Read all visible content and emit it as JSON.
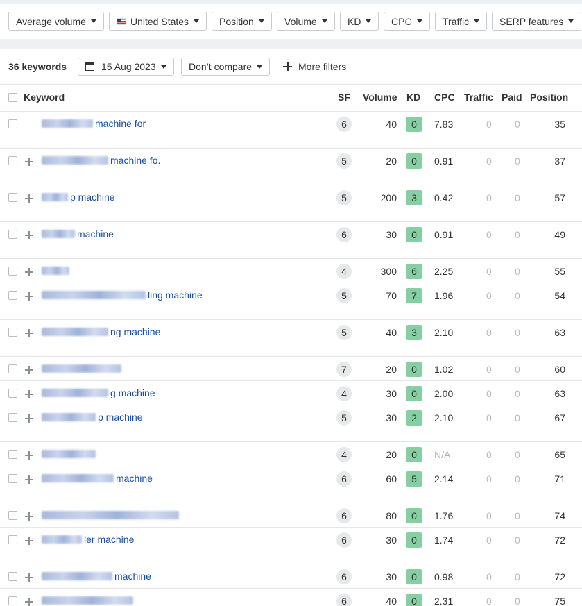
{
  "filters": [
    {
      "label": "Average volume"
    },
    {
      "label": "United States",
      "flag": true
    },
    {
      "label": "Position"
    },
    {
      "label": "Volume"
    },
    {
      "label": "KD"
    },
    {
      "label": "CPC"
    },
    {
      "label": "Traffic"
    },
    {
      "label": "SERP features"
    }
  ],
  "subbar": {
    "keyword_count": "36 keywords",
    "date": "15 Aug 2023",
    "compare": "Don’t compare",
    "more_filters": "More filters"
  },
  "table": {
    "headers": {
      "keyword": "Keyword",
      "sf": "SF",
      "volume": "Volume",
      "kd": "KD",
      "cpc": "CPC",
      "traffic": "Traffic",
      "paid": "Paid",
      "position": "Position"
    },
    "rows": [
      {
        "kw": "machine for",
        "sf": "6",
        "volume": "40",
        "kd": "0",
        "cpc": "7.83",
        "traffic": "0",
        "paid": "0",
        "position": "35"
      },
      {
        "kw": "machine fo.",
        "sf": "5",
        "volume": "20",
        "kd": "0",
        "cpc": "0.91",
        "traffic": "0",
        "paid": "0",
        "position": "37"
      },
      {
        "kw": "p machine",
        "sf": "5",
        "volume": "200",
        "kd": "3",
        "cpc": "0.42",
        "traffic": "0",
        "paid": "0",
        "position": "57"
      },
      {
        "kw": "machine",
        "sf": "6",
        "volume": "30",
        "kd": "0",
        "cpc": "0.91",
        "traffic": "0",
        "paid": "0",
        "position": "49"
      },
      {
        "kw": "",
        "sf": "4",
        "volume": "300",
        "kd": "6",
        "cpc": "2.25",
        "traffic": "0",
        "paid": "0",
        "position": "55"
      },
      {
        "kw": "ling machine",
        "sf": "5",
        "volume": "70",
        "kd": "7",
        "cpc": "1.96",
        "traffic": "0",
        "paid": "0",
        "position": "54"
      },
      {
        "kw": "ng machine",
        "sf": "5",
        "volume": "40",
        "kd": "3",
        "cpc": "2.10",
        "traffic": "0",
        "paid": "0",
        "position": "63"
      },
      {
        "kw": "",
        "sf": "7",
        "volume": "20",
        "kd": "0",
        "cpc": "1.02",
        "traffic": "0",
        "paid": "0",
        "position": "60"
      },
      {
        "kw": "g machine",
        "sf": "4",
        "volume": "30",
        "kd": "0",
        "cpc": "2.00",
        "traffic": "0",
        "paid": "0",
        "position": "63"
      },
      {
        "kw": "p machine",
        "sf": "5",
        "volume": "30",
        "kd": "2",
        "cpc": "2.10",
        "traffic": "0",
        "paid": "0",
        "position": "67"
      },
      {
        "kw": "",
        "sf": "4",
        "volume": "20",
        "kd": "0",
        "cpc": "N/A",
        "traffic": "0",
        "paid": "0",
        "position": "65"
      },
      {
        "kw": "machine",
        "sf": "6",
        "volume": "60",
        "kd": "5",
        "cpc": "2.14",
        "traffic": "0",
        "paid": "0",
        "position": "71"
      },
      {
        "kw": "",
        "sf": "6",
        "volume": "80",
        "kd": "0",
        "cpc": "1.76",
        "traffic": "0",
        "paid": "0",
        "position": "74"
      },
      {
        "kw": "ler machine",
        "sf": "6",
        "volume": "30",
        "kd": "0",
        "cpc": "1.74",
        "traffic": "0",
        "paid": "0",
        "position": "72"
      },
      {
        "kw": "machine",
        "sf": "6",
        "volume": "30",
        "kd": "0",
        "cpc": "0.98",
        "traffic": "0",
        "paid": "0",
        "position": "72"
      },
      {
        "kw": "",
        "sf": "6",
        "volume": "40",
        "kd": "0",
        "cpc": "2.31",
        "traffic": "0",
        "paid": "0",
        "position": "75"
      }
    ]
  },
  "colors": {
    "kd_badge": "#86cfa2",
    "link": "#1a4f9c"
  }
}
